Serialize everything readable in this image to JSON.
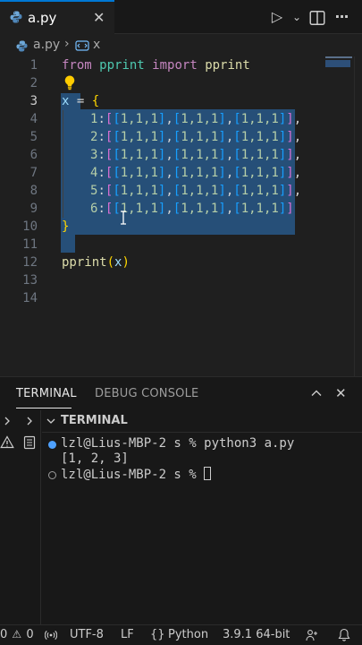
{
  "tab": {
    "filename": "a.py",
    "close_glyph": "✕"
  },
  "toolbar": {
    "run_glyph": "▷",
    "split_glyph": "⫼",
    "more_glyph": "···"
  },
  "breadcrumb": {
    "file": "a.py",
    "separator": "›",
    "symbol": "x"
  },
  "editor": {
    "line_numbers": [
      "1",
      "2",
      "3",
      "4",
      "5",
      "6",
      "7",
      "8",
      "9",
      "10",
      "11",
      "12",
      "13",
      "14"
    ],
    "active_line": "3",
    "code": {
      "l1_kw1": "from",
      "l1_mod": "pprint",
      "l1_kw2": "import",
      "l1_name": "pprint",
      "l3_var": "x",
      "l3_eq": " = ",
      "l3_brace": "{",
      "rows": [
        {
          "key": "1",
          "vals": "1,1,1"
        },
        {
          "key": "2",
          "vals": "1,1,1"
        },
        {
          "key": "3",
          "vals": "1,1,1"
        },
        {
          "key": "4",
          "vals": "1,1,1"
        },
        {
          "key": "5",
          "vals": "1,1,1"
        },
        {
          "key": "6",
          "vals": "1,1,1"
        }
      ],
      "l10_brace": "}",
      "l12_fn": "pprint",
      "l12_open": "(",
      "l12_arg": "x",
      "l12_close": ")"
    }
  },
  "colors": {
    "accent": "#0078d4",
    "selection": "#264f78"
  },
  "panel": {
    "tab_terminal": "TERMINAL",
    "tab_debug": "DEBUG CONSOLE",
    "chevron_up": "⌃",
    "close_glyph": "✕",
    "section_title": "TERMINAL",
    "lines": [
      "lzl@Lius-MBP-2 s % python3 a.py",
      "[1, 2, 3]",
      "lzl@Lius-MBP-2 s % "
    ]
  },
  "status": {
    "errors": "0",
    "warnings": "0",
    "encoding": "UTF-8",
    "eol": "LF",
    "language": "Python",
    "interpreter": "3.9.1 64-bit"
  }
}
